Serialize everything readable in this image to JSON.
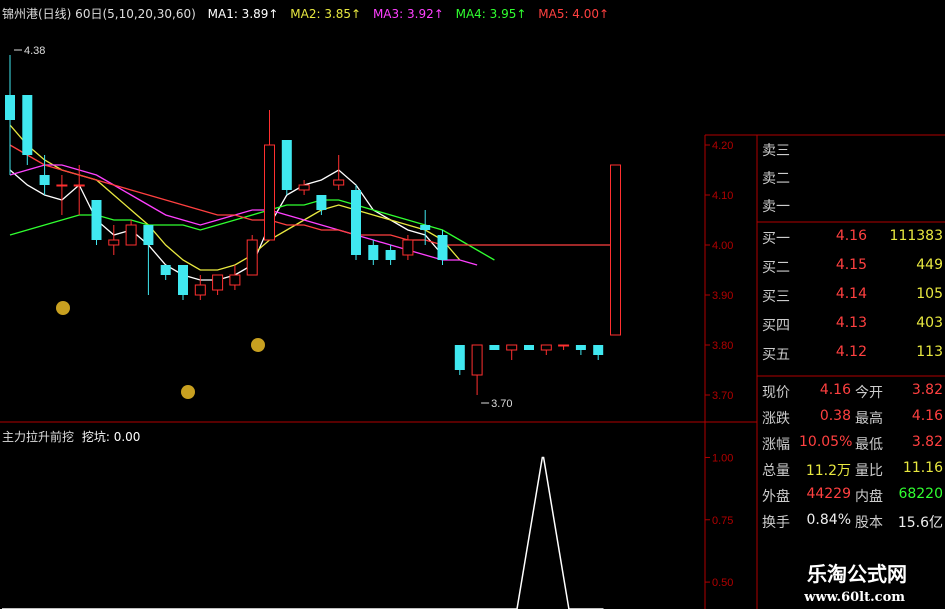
{
  "header": {
    "title": "锦州港(日线) 60日(5,10,20,30,60)",
    "ma1": "MA1: 3.89↑",
    "ma2": "MA2: 3.85↑",
    "ma3": "MA3: 3.92↑",
    "ma4": "MA4: 3.95↑",
    "ma5": "MA5: 4.00↑"
  },
  "indicator": {
    "title": "主力拉升前挖",
    "label": "挖坑: 0.00"
  },
  "order_book": {
    "sell": [
      {
        "label": "卖三",
        "price": "",
        "volume": ""
      },
      {
        "label": "卖二",
        "price": "",
        "volume": ""
      },
      {
        "label": "卖一",
        "price": "",
        "volume": ""
      }
    ],
    "buy": [
      {
        "label": "买一",
        "price": "4.16",
        "volume": "111383"
      },
      {
        "label": "买二",
        "price": "4.15",
        "volume": "449"
      },
      {
        "label": "买三",
        "price": "4.14",
        "volume": "105"
      },
      {
        "label": "买四",
        "price": "4.13",
        "volume": "403"
      },
      {
        "label": "买五",
        "price": "4.12",
        "volume": "113"
      }
    ]
  },
  "quote": [
    {
      "k1": "现价",
      "v1": "4.16",
      "k2": "今开",
      "v2": "3.82"
    },
    {
      "k1": "涨跌",
      "v1": "0.38",
      "k2": "最高",
      "v2": "4.16"
    },
    {
      "k1": "涨幅",
      "v1": "10.05%",
      "k2": "最低",
      "v2": "3.82"
    },
    {
      "k1": "总量",
      "v1": "11.2万",
      "k2": "量比",
      "v2": "11.16"
    },
    {
      "k1": "外盘",
      "v1": "44229",
      "k2": "内盘",
      "v2": "68220"
    },
    {
      "k1": "换手",
      "v1": "0.84%",
      "k2": "股本",
      "v2": "15.6亿"
    }
  ],
  "watermark": {
    "name": "乐淘公式网",
    "url": "www.60lt.com"
  },
  "colors": {
    "up": "#ff3030",
    "down": "#40e8f0",
    "ma1": "#ffffff",
    "ma2": "#e8e840",
    "ma3": "#ff40ff",
    "ma4": "#30ff30",
    "ma5": "#ff4040",
    "axis": "#b00000"
  },
  "chart_data": [
    {
      "type": "candlestick",
      "ylim": [
        3.65,
        4.45
      ],
      "y_ticks": [
        "4.20",
        "4.10",
        "4.00",
        "3.90",
        "3.80",
        "3.70"
      ],
      "annotations": [
        {
          "label": "4.38",
          "value": 4.38
        },
        {
          "label": "3.70",
          "value": 3.7
        }
      ],
      "candles": [
        {
          "o": 4.3,
          "c": 4.25,
          "h": 4.38,
          "l": 4.14
        },
        {
          "o": 4.3,
          "c": 4.18,
          "h": 4.3,
          "l": 4.16
        },
        {
          "o": 4.14,
          "c": 4.12,
          "h": 4.18,
          "l": 4.1
        },
        {
          "o": 4.12,
          "c": 4.12,
          "h": 4.14,
          "l": 4.06
        },
        {
          "o": 4.12,
          "c": 4.12,
          "h": 4.16,
          "l": 4.06
        },
        {
          "o": 4.09,
          "c": 4.01,
          "h": 4.09,
          "l": 4.0
        },
        {
          "o": 4.0,
          "c": 4.01,
          "h": 4.04,
          "l": 3.98
        },
        {
          "o": 4.0,
          "c": 4.04,
          "h": 4.05,
          "l": 4.0
        },
        {
          "o": 4.04,
          "c": 4.0,
          "h": 4.04,
          "l": 3.9
        },
        {
          "o": 3.96,
          "c": 3.94,
          "h": 3.96,
          "l": 3.93
        },
        {
          "o": 3.96,
          "c": 3.9,
          "h": 3.96,
          "l": 3.89
        },
        {
          "o": 3.9,
          "c": 3.92,
          "h": 3.94,
          "l": 3.89
        },
        {
          "o": 3.91,
          "c": 3.94,
          "h": 3.94,
          "l": 3.9
        },
        {
          "o": 3.92,
          "c": 3.94,
          "h": 3.96,
          "l": 3.91
        },
        {
          "o": 3.94,
          "c": 4.01,
          "h": 4.02,
          "l": 3.94
        },
        {
          "o": 4.01,
          "c": 4.2,
          "h": 4.27,
          "l": 4.01
        },
        {
          "o": 4.21,
          "c": 4.11,
          "h": 4.21,
          "l": 4.1
        },
        {
          "o": 4.11,
          "c": 4.12,
          "h": 4.13,
          "l": 4.1
        },
        {
          "o": 4.1,
          "c": 4.07,
          "h": 4.1,
          "l": 4.06
        },
        {
          "o": 4.12,
          "c": 4.13,
          "h": 4.18,
          "l": 4.11
        },
        {
          "o": 4.11,
          "c": 3.98,
          "h": 4.12,
          "l": 3.97
        },
        {
          "o": 4.0,
          "c": 3.97,
          "h": 4.01,
          "l": 3.96
        },
        {
          "o": 3.99,
          "c": 3.97,
          "h": 4.0,
          "l": 3.96
        },
        {
          "o": 3.98,
          "c": 4.01,
          "h": 4.02,
          "l": 3.97
        },
        {
          "o": 4.04,
          "c": 4.03,
          "h": 4.07,
          "l": 4.0
        },
        {
          "o": 4.02,
          "c": 3.97,
          "h": 4.03,
          "l": 3.96
        },
        {
          "o": 3.8,
          "c": 3.75,
          "h": 3.8,
          "l": 3.74
        },
        {
          "o": 3.74,
          "c": 3.8,
          "h": 3.8,
          "l": 3.7
        },
        {
          "o": 3.8,
          "c": 3.79,
          "h": 3.8,
          "l": 3.79
        },
        {
          "o": 3.79,
          "c": 3.8,
          "h": 3.8,
          "l": 3.77
        },
        {
          "o": 3.8,
          "c": 3.79,
          "h": 3.8,
          "l": 3.79
        },
        {
          "o": 3.79,
          "c": 3.8,
          "h": 3.8,
          "l": 3.78
        },
        {
          "o": 3.8,
          "c": 3.8,
          "h": 3.8,
          "l": 3.79
        },
        {
          "o": 3.8,
          "c": 3.79,
          "h": 3.8,
          "l": 3.78
        },
        {
          "o": 3.8,
          "c": 3.78,
          "h": 3.8,
          "l": 3.77
        },
        {
          "o": 3.82,
          "c": 4.16,
          "h": 4.16,
          "l": 3.82
        }
      ],
      "ma_series": [
        {
          "name": "MA1",
          "start": 0,
          "values": [
            4.15,
            4.12,
            4.1,
            4.09,
            4.12,
            4.05,
            4.02,
            4.03,
            4.0,
            3.96,
            3.94,
            3.93,
            3.93,
            3.94,
            3.96,
            4.04,
            4.1,
            4.12,
            4.13,
            4.15,
            4.12,
            4.07,
            4.05,
            4.03,
            4.02,
            3.98
          ]
        },
        {
          "name": "MA2",
          "start": 0,
          "values": [
            4.24,
            4.2,
            4.17,
            4.15,
            4.14,
            4.13,
            4.1,
            4.07,
            4.04,
            4.0,
            3.97,
            3.95,
            3.95,
            3.96,
            3.98,
            4.01,
            4.03,
            4.05,
            4.07,
            4.08,
            4.07,
            4.06,
            4.05,
            4.04,
            4.03,
            4.01,
            3.97
          ]
        },
        {
          "name": "MA3",
          "start": 0,
          "values": [
            4.14,
            4.15,
            4.16,
            4.16,
            4.15,
            4.14,
            4.12,
            4.1,
            4.08,
            4.06,
            4.05,
            4.04,
            4.05,
            4.06,
            4.07,
            4.07,
            4.06,
            4.05,
            4.04,
            4.03,
            4.02,
            4.01,
            4.0,
            3.99,
            3.98,
            3.97,
            3.97,
            3.96
          ]
        },
        {
          "name": "MA4",
          "start": 0,
          "values": [
            4.02,
            4.03,
            4.04,
            4.05,
            4.06,
            4.06,
            4.05,
            4.05,
            4.04,
            4.04,
            4.04,
            4.03,
            4.04,
            4.05,
            4.06,
            4.07,
            4.08,
            4.08,
            4.09,
            4.09,
            4.08,
            4.07,
            4.06,
            4.05,
            4.04,
            4.03,
            4.01,
            3.99,
            3.97
          ]
        },
        {
          "name": "MA5",
          "start": 0,
          "values": [
            4.2,
            4.18,
            4.16,
            4.15,
            4.14,
            4.13,
            4.12,
            4.11,
            4.1,
            4.09,
            4.08,
            4.07,
            4.06,
            4.06,
            4.05,
            4.05,
            4.04,
            4.04,
            4.03,
            4.03,
            4.02,
            4.02,
            4.02,
            4.01,
            4.01,
            4.0,
            4.0,
            4.0,
            4.0,
            4.0,
            4.0,
            4.0,
            4.0,
            4.0,
            4.0,
            4.0
          ]
        }
      ]
    },
    {
      "type": "line",
      "name": "挖坑",
      "ylim": [
        0.4,
        1.05
      ],
      "y_ticks": [
        "1.00",
        "0.75",
        "0.50"
      ],
      "x": [
        0,
        30,
        31,
        32,
        33,
        34,
        35
      ],
      "values": [
        0,
        0,
        1,
        1,
        0,
        0,
        0
      ]
    }
  ]
}
